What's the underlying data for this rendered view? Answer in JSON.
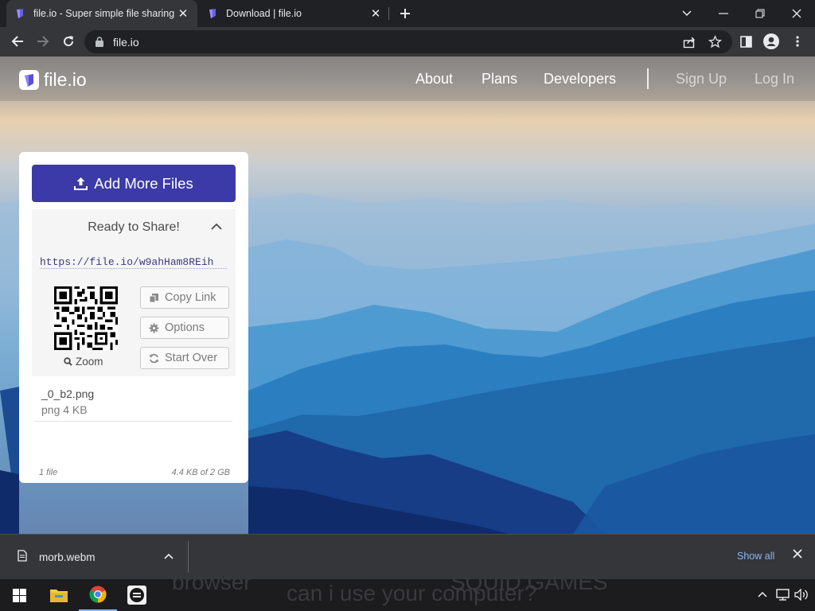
{
  "browser": {
    "tabs": [
      {
        "title": "file.io - Super simple file sharing",
        "active": true
      },
      {
        "title": "Download | file.io",
        "active": false
      }
    ],
    "address": "file.io"
  },
  "site": {
    "logo_text": "file.io",
    "nav": {
      "about": "About",
      "plans": "Plans",
      "developers": "Developers",
      "sign_up": "Sign Up",
      "log_in": "Log In"
    }
  },
  "card": {
    "add_button": "Add More Files",
    "ready_label": "Ready to Share!",
    "share_url": "https://file.io/w9ahHam8REih",
    "zoom_label": "Zoom",
    "buttons": {
      "copy": "Copy Link",
      "options": "Options",
      "start_over": "Start Over"
    },
    "file": {
      "name": "_0_b2.png",
      "meta": "png 4 KB"
    },
    "footer": {
      "count": "1 file",
      "size": "4.4 KB of 2 GB"
    }
  },
  "downloads": {
    "file": "morb.webm",
    "show_all": "Show all"
  },
  "taskbar": {
    "background_text_1": "browser",
    "background_text_2": "can i use your computer?",
    "background_text_3": "SQUID GAMES"
  },
  "colors": {
    "primary": "#3c3aa8",
    "chrome_dark": "#202124",
    "chrome_mid": "#35363a",
    "link": "#8ab4f8"
  }
}
